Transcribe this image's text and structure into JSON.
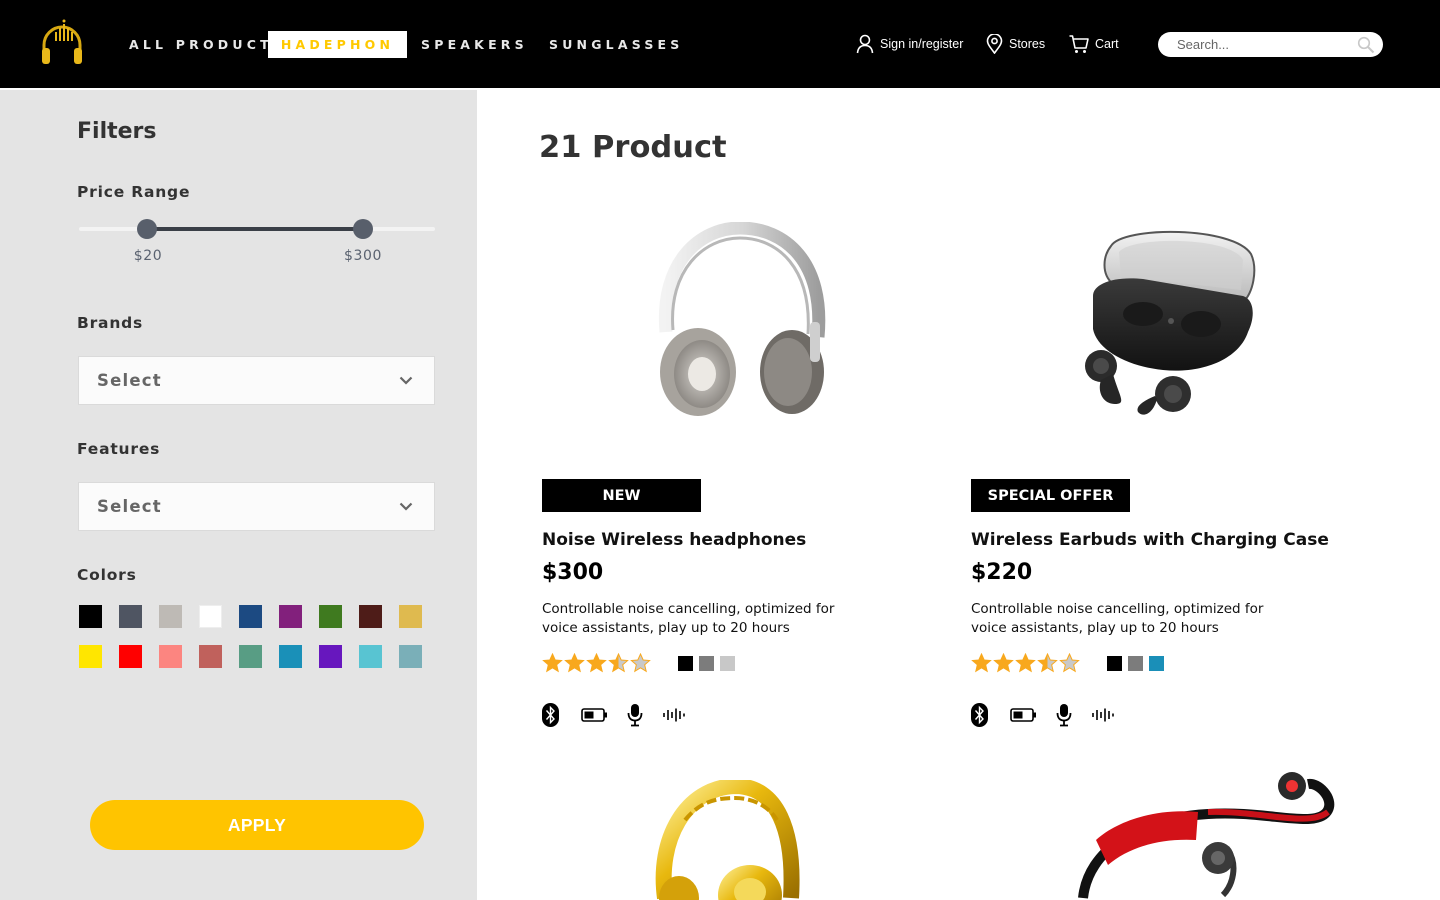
{
  "header": {
    "logo_icon": "headphones-crown-logo",
    "nav": [
      {
        "label": "ALL PRODUCT",
        "active": false
      },
      {
        "label": "HADEPHON",
        "active": true
      },
      {
        "label": "SPEAKERS",
        "active": false
      },
      {
        "label": "SUNGLASSES",
        "active": false
      }
    ],
    "sign_in": "Sign in/register",
    "stores": "Stores",
    "cart": "Cart",
    "search_placeholder": "Search..."
  },
  "filters": {
    "title": "Filters",
    "price_range": {
      "title": "Price Range",
      "min_label": "$20",
      "max_label": "$300",
      "min": 20,
      "max": 300
    },
    "brands": {
      "title": "Brands",
      "value": "Select"
    },
    "features": {
      "title": "Features",
      "value": "Select"
    },
    "colors": {
      "title": "Colors",
      "swatches": [
        "#000000",
        "#4f5562",
        "#bebab5",
        "#ffffff",
        "#1c4a82",
        "#82207c",
        "#3f7a1f",
        "#4e1c18",
        "#dfba4f",
        "#ffe600",
        "#ff0000",
        "#fc8580",
        "#c0615c",
        "#589d84",
        "#1a90b8",
        "#6717be",
        "#58c4d2",
        "#7aafb8"
      ]
    },
    "apply_label": "APPLY"
  },
  "main": {
    "count_label": "21 Product",
    "products": [
      {
        "badge": "NEW",
        "name": "Noise Wireless headphones",
        "price": "$300",
        "description": "Controllable noise cancelling, optimized for voice assistants, play up to 20 hours",
        "rating": 3.5,
        "colors": [
          "#000000",
          "#7c7c7c",
          "#c8c8c8"
        ],
        "features": [
          "bluetooth-icon",
          "battery-icon",
          "microphone-icon",
          "sound-wave-icon"
        ],
        "image": "silver-headphones"
      },
      {
        "badge": "SPECIAL OFFER",
        "name": "Wireless Earbuds with Charging Case",
        "price": "$220",
        "description": "Controllable noise cancelling, optimized for voice assistants, play up to 20 hours",
        "rating": 3.5,
        "colors": [
          "#000000",
          "#7c7c7c",
          "#1a8fb8"
        ],
        "features": [
          "bluetooth-icon",
          "battery-icon",
          "microphone-icon",
          "sound-wave-icon"
        ],
        "image": "earbuds-charging-case"
      }
    ],
    "more_images": [
      "gold-headphones",
      "red-sport-earphones"
    ]
  },
  "colors": {
    "header_bg": "#000000",
    "accent": "#ffc400",
    "sidebar_bg": "#e4e4e4",
    "star": "#f8a81d"
  }
}
